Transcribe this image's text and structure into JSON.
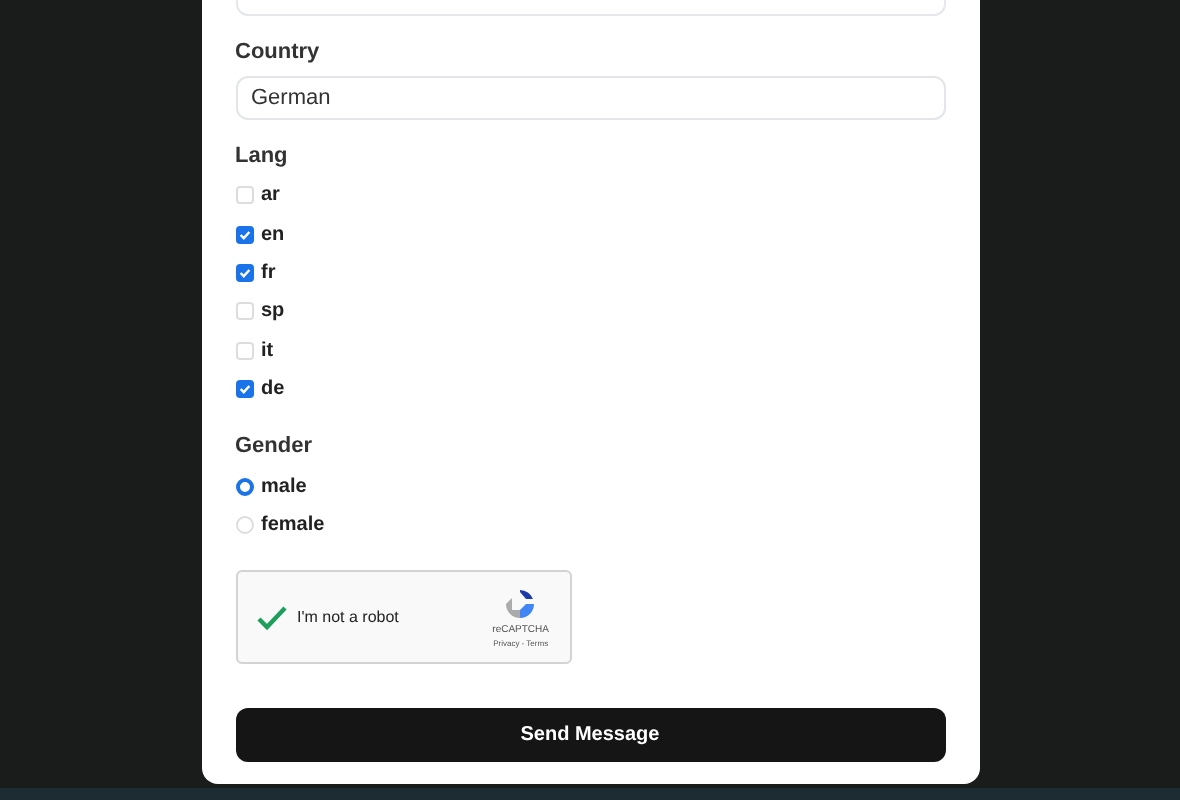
{
  "country": {
    "label": "Country",
    "value": "German"
  },
  "lang": {
    "label": "Lang",
    "options": [
      {
        "label": "ar",
        "checked": false
      },
      {
        "label": "en",
        "checked": true
      },
      {
        "label": "fr",
        "checked": true
      },
      {
        "label": "sp",
        "checked": false
      },
      {
        "label": "it",
        "checked": false
      },
      {
        "label": "de",
        "checked": true
      }
    ]
  },
  "gender": {
    "label": "Gender",
    "options": [
      {
        "label": "male",
        "selected": true
      },
      {
        "label": "female",
        "selected": false
      }
    ]
  },
  "captcha": {
    "label": "I'm not a robot",
    "checked": true,
    "brand": "reCAPTCHA",
    "links": "Privacy - Terms"
  },
  "submit": "Send Message"
}
